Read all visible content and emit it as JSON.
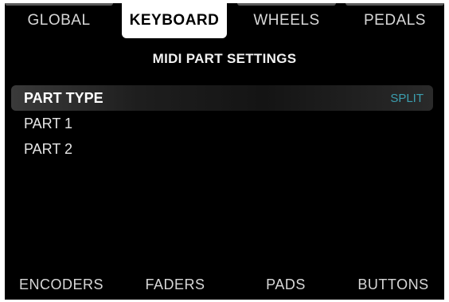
{
  "top_tabs": {
    "global": "GLOBAL",
    "keyboard": "KEYBOARD",
    "wheels": "WHEELS",
    "pedals": "PEDALS",
    "active": "keyboard"
  },
  "page": {
    "title": "MIDI PART SETTINGS"
  },
  "params": [
    {
      "label": "PART TYPE",
      "value": "SPLIT",
      "selected": true
    },
    {
      "label": "PART 1",
      "value": "",
      "selected": false
    },
    {
      "label": "PART 2",
      "value": "",
      "selected": false
    }
  ],
  "bottom_tabs": {
    "encoders": "ENCODERS",
    "faders": "FADERS",
    "pads": "PADS",
    "buttons": "BUTTONS"
  },
  "colors": {
    "background": "#000000",
    "active_tab_bg": "#ffffff",
    "value_accent": "#3fb3c6"
  }
}
